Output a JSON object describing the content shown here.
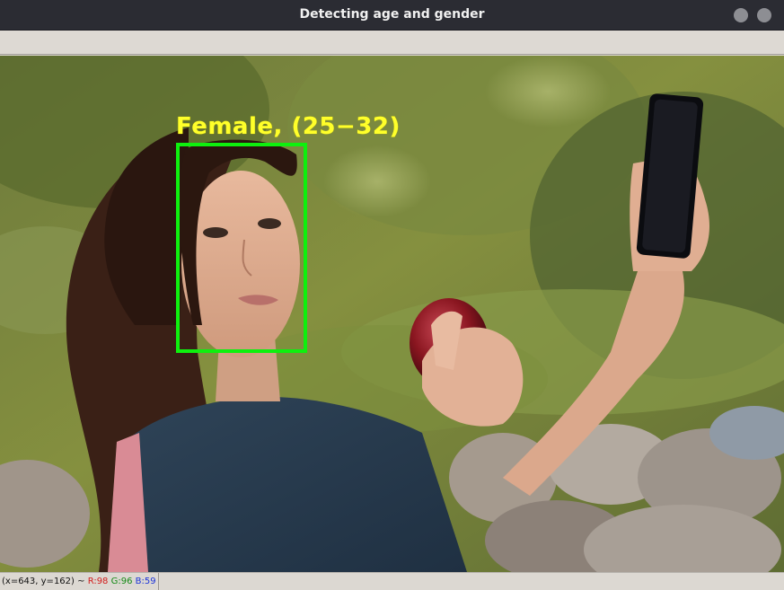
{
  "window": {
    "title": "Detecting age and gender"
  },
  "detection": {
    "label": "Female, (25−32)",
    "box_color": "#0ef00e",
    "label_color": "#ffff2a"
  },
  "status": {
    "coords": "(x=643, y=162) ~",
    "r": "R:98",
    "g": "G:96",
    "b": "B:59"
  },
  "icons": {
    "window_controls": [
      "minimize-button",
      "close-button"
    ]
  }
}
